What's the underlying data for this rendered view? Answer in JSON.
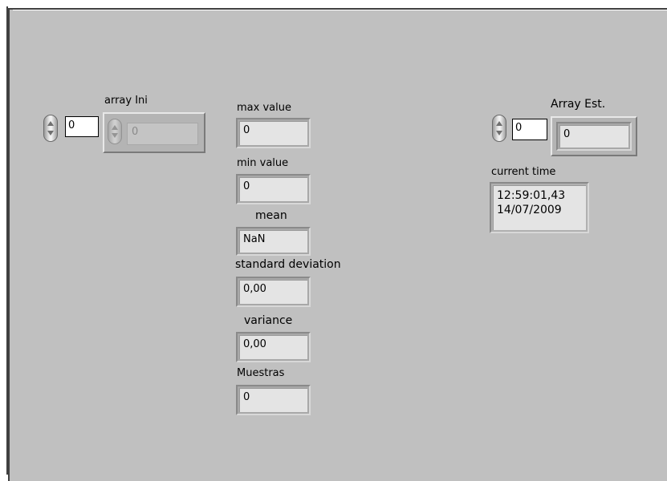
{
  "array_ini": {
    "label": "array Ini",
    "index_value": "0",
    "element_value": "0"
  },
  "stats": {
    "max_value": {
      "label": "max value",
      "value": "0"
    },
    "min_value": {
      "label": "min value",
      "value": "0"
    },
    "mean": {
      "label": "mean",
      "value": "NaN"
    },
    "standard_deviation": {
      "label": "standard deviation",
      "value": "0,00"
    },
    "variance": {
      "label": "variance",
      "value": "0,00"
    },
    "muestras": {
      "label": "Muestras",
      "value": "0"
    }
  },
  "array_est": {
    "label": "Array Est.",
    "index_value": "0",
    "element_value": "0"
  },
  "current_time": {
    "label": "current time",
    "time": "12:59:01,43",
    "date": "14/07/2009"
  },
  "icons": {
    "spinner": "increment-decrement-icon"
  },
  "colors": {
    "panel_background": "#c0c0c0",
    "indicator_field": "#e4e4e4",
    "control_field": "#ffffff"
  }
}
